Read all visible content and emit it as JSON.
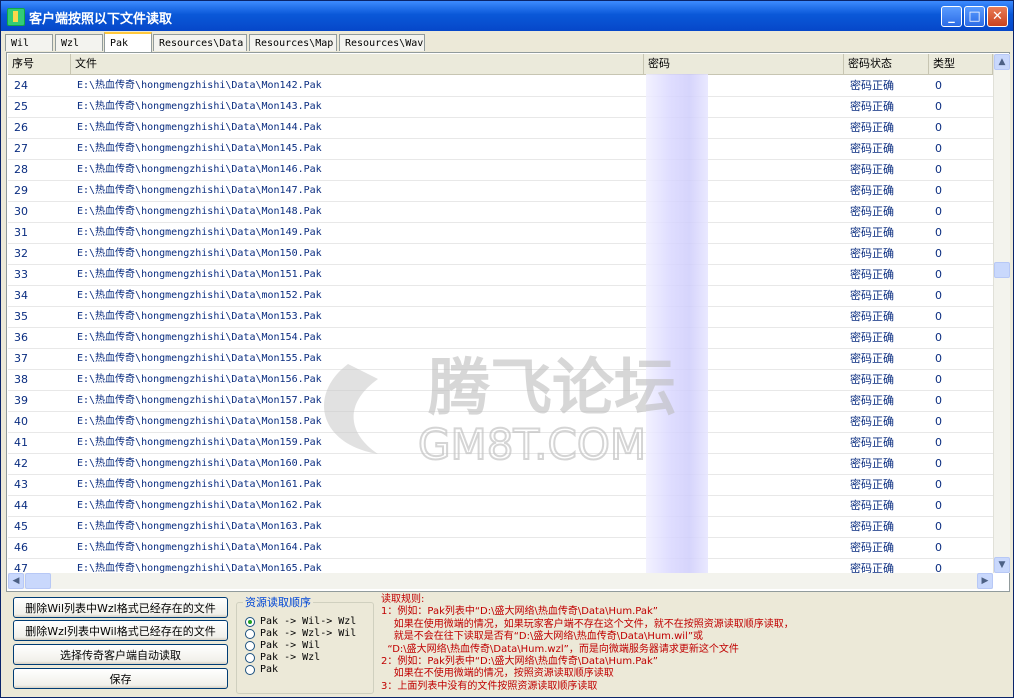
{
  "window": {
    "title": "客户端按照以下文件读取",
    "min": "_",
    "max": "□",
    "close": "✕"
  },
  "tabs": [
    "Wil",
    "Wzl",
    "Pak",
    "Resources\\Data",
    "Resources\\Map",
    "Resources\\Wav"
  ],
  "active_tab": "Pak",
  "table": {
    "headers": [
      "序号",
      "文件",
      "密码",
      "密码状态",
      "类型"
    ],
    "rows": [
      {
        "no": "24",
        "file": "E:\\热血传奇\\hongmengzhishi\\Data\\Mon142.Pak",
        "status": "密码正确",
        "type": "0"
      },
      {
        "no": "25",
        "file": "E:\\热血传奇\\hongmengzhishi\\Data\\Mon143.Pak",
        "status": "密码正确",
        "type": "0"
      },
      {
        "no": "26",
        "file": "E:\\热血传奇\\hongmengzhishi\\Data\\Mon144.Pak",
        "status": "密码正确",
        "type": "0"
      },
      {
        "no": "27",
        "file": "E:\\热血传奇\\hongmengzhishi\\Data\\Mon145.Pak",
        "status": "密码正确",
        "type": "0"
      },
      {
        "no": "28",
        "file": "E:\\热血传奇\\hongmengzhishi\\Data\\Mon146.Pak",
        "status": "密码正确",
        "type": "0"
      },
      {
        "no": "29",
        "file": "E:\\热血传奇\\hongmengzhishi\\Data\\Mon147.Pak",
        "status": "密码正确",
        "type": "0"
      },
      {
        "no": "30",
        "file": "E:\\热血传奇\\hongmengzhishi\\Data\\Mon148.Pak",
        "status": "密码正确",
        "type": "0"
      },
      {
        "no": "31",
        "file": "E:\\热血传奇\\hongmengzhishi\\Data\\Mon149.Pak",
        "status": "密码正确",
        "type": "0"
      },
      {
        "no": "32",
        "file": "E:\\热血传奇\\hongmengzhishi\\Data\\Mon150.Pak",
        "status": "密码正确",
        "type": "0"
      },
      {
        "no": "33",
        "file": "E:\\热血传奇\\hongmengzhishi\\Data\\Mon151.Pak",
        "status": "密码正确",
        "type": "0"
      },
      {
        "no": "34",
        "file": "E:\\热血传奇\\hongmengzhishi\\Data\\mon152.Pak",
        "status": "密码正确",
        "type": "0"
      },
      {
        "no": "35",
        "file": "E:\\热血传奇\\hongmengzhishi\\Data\\Mon153.Pak",
        "status": "密码正确",
        "type": "0"
      },
      {
        "no": "36",
        "file": "E:\\热血传奇\\hongmengzhishi\\Data\\Mon154.Pak",
        "status": "密码正确",
        "type": "0"
      },
      {
        "no": "37",
        "file": "E:\\热血传奇\\hongmengzhishi\\Data\\Mon155.Pak",
        "status": "密码正确",
        "type": "0"
      },
      {
        "no": "38",
        "file": "E:\\热血传奇\\hongmengzhishi\\Data\\Mon156.Pak",
        "status": "密码正确",
        "type": "0"
      },
      {
        "no": "39",
        "file": "E:\\热血传奇\\hongmengzhishi\\Data\\Mon157.Pak",
        "status": "密码正确",
        "type": "0"
      },
      {
        "no": "40",
        "file": "E:\\热血传奇\\hongmengzhishi\\Data\\Mon158.Pak",
        "status": "密码正确",
        "type": "0"
      },
      {
        "no": "41",
        "file": "E:\\热血传奇\\hongmengzhishi\\Data\\Mon159.Pak",
        "status": "密码正确",
        "type": "0"
      },
      {
        "no": "42",
        "file": "E:\\热血传奇\\hongmengzhishi\\Data\\Mon160.Pak",
        "status": "密码正确",
        "type": "0"
      },
      {
        "no": "43",
        "file": "E:\\热血传奇\\hongmengzhishi\\Data\\Mon161.Pak",
        "status": "密码正确",
        "type": "0"
      },
      {
        "no": "44",
        "file": "E:\\热血传奇\\hongmengzhishi\\Data\\Mon162.Pak",
        "status": "密码正确",
        "type": "0"
      },
      {
        "no": "45",
        "file": "E:\\热血传奇\\hongmengzhishi\\Data\\Mon163.Pak",
        "status": "密码正确",
        "type": "0"
      },
      {
        "no": "46",
        "file": "E:\\热血传奇\\hongmengzhishi\\Data\\Mon164.Pak",
        "status": "密码正确",
        "type": "0"
      },
      {
        "no": "47",
        "file": "E:\\热血传奇\\hongmengzhishi\\Data\\Mon165.Pak",
        "status": "密码正确",
        "type": "0"
      }
    ]
  },
  "buttons": [
    "删除Wil列表中Wzl格式已经存在的文件",
    "删除Wzl列表中Wil格式已经存在的文件",
    "选择传奇客户端自动读取",
    "保存"
  ],
  "order_group": {
    "title": "资源读取顺序",
    "options": [
      "Pak -> Wil-> Wzl",
      "Pak -> Wzl-> Wil",
      "Pak -> Wil",
      "Pak -> Wzl",
      "Pak"
    ],
    "selected_index": 0
  },
  "rules": {
    "lines": [
      "读取规则:",
      "1：例如：Pak列表中“D:\\盛大网络\\热血传奇\\Data\\Hum.Pak”",
      "    如果在使用微端的情况，如果玩家客户端不存在这个文件，就不在按照资源读取顺序读取，",
      "    就是不会在往下读取是否有“D:\\盛大网络\\热血传奇\\Data\\Hum.wil”或",
      "  “D:\\盛大网络\\热血传奇\\Data\\Hum.wzl”，而是向微端服务器请求更新这个文件",
      "2：例如：Pak列表中“D:\\盛大网络\\热血传奇\\Data\\Hum.Pak”",
      "    如果在不使用微端的情况，按照资源读取顺序读取",
      "3：上面列表中没有的文件按照资源读取顺序读取"
    ]
  },
  "watermark": {
    "text": "腾飞论坛",
    "subtext": "GM8T.COM"
  },
  "colors": {
    "title_bar": "#0a58d8",
    "rules_text": "#c00000",
    "group_title": "#0046d5",
    "list_text": "#0a2d80"
  }
}
